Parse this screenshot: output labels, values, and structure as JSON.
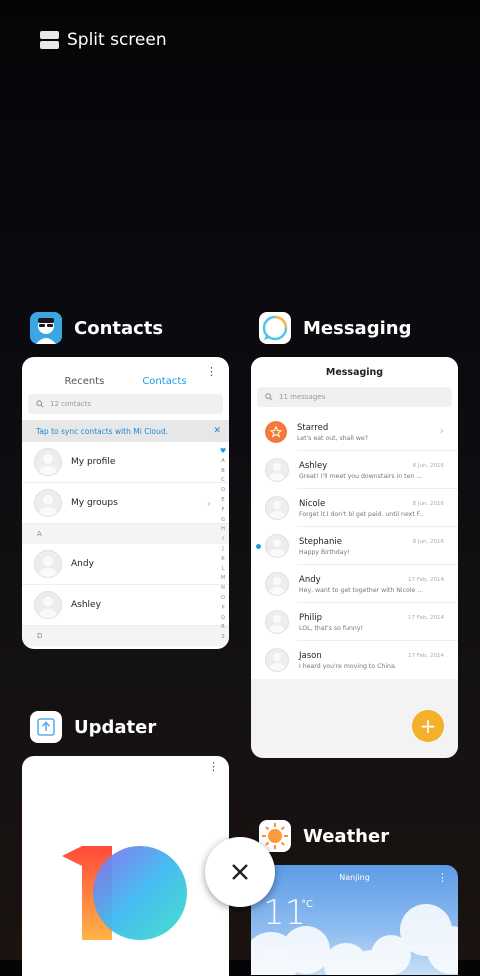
{
  "split_screen": {
    "label": "Split screen",
    "icon": "split-screen-icon"
  },
  "apps": {
    "contacts": {
      "name": "Contacts",
      "icon": "contacts-icon",
      "tabs": [
        "Recents",
        "Contacts"
      ],
      "active_tab": "Contacts",
      "search_placeholder": "12 contacts",
      "sync_banner": "Tap to sync contacts with Mi Cloud.",
      "rows": [
        {
          "label": "My profile"
        },
        {
          "label": "My groups"
        }
      ],
      "sections": [
        {
          "letter": "A",
          "names": [
            "Andy",
            "Ashley"
          ]
        },
        {
          "letter": "D",
          "names": []
        }
      ],
      "alphabet": [
        "A",
        "B",
        "C",
        "D",
        "E",
        "F",
        "G",
        "H",
        "I",
        "J",
        "K",
        "L",
        "M",
        "N",
        "O",
        "P",
        "Q",
        "R",
        "S"
      ]
    },
    "messaging": {
      "name": "Messaging",
      "icon": "messaging-icon",
      "title": "Messaging",
      "search_placeholder": "11 messages",
      "starred": {
        "name": "Starred",
        "preview": "Let's eat out, shall we?"
      },
      "messages": [
        {
          "name": "Ashley",
          "preview": "Great! I'll meet you downstairs in ten ...",
          "date": "8 Jun, 2016",
          "unread": false
        },
        {
          "name": "Nicole",
          "preview": "Forget it.I don't bl get paid. until next F...",
          "date": "8 Jun, 2016",
          "unread": false
        },
        {
          "name": "Stephanie",
          "preview": "Happy Birthday!",
          "date": "8 Jun, 2016",
          "unread": true
        },
        {
          "name": "Andy",
          "preview": "Hey, want to get together with Nicole ...",
          "date": "17 Feb, 2014",
          "unread": false
        },
        {
          "name": "Philip",
          "preview": "LOL, that's so funny!",
          "date": "17 Feb, 2014",
          "unread": false
        },
        {
          "name": "Jason",
          "preview": "I heard you're moving to China.",
          "date": "17 Feb, 2014",
          "unread": false
        }
      ],
      "fab_label": "+"
    },
    "updater": {
      "name": "Updater",
      "icon": "updater-icon"
    },
    "weather": {
      "name": "Weather",
      "icon": "weather-icon",
      "city": "Nanjing",
      "temp": "11",
      "unit": "°C",
      "condition": "Cloudy"
    }
  },
  "close_label": "✕",
  "colors": {
    "accent": "#1e9be8",
    "fab": "#f4b02a",
    "starred": "#f47a3c"
  }
}
